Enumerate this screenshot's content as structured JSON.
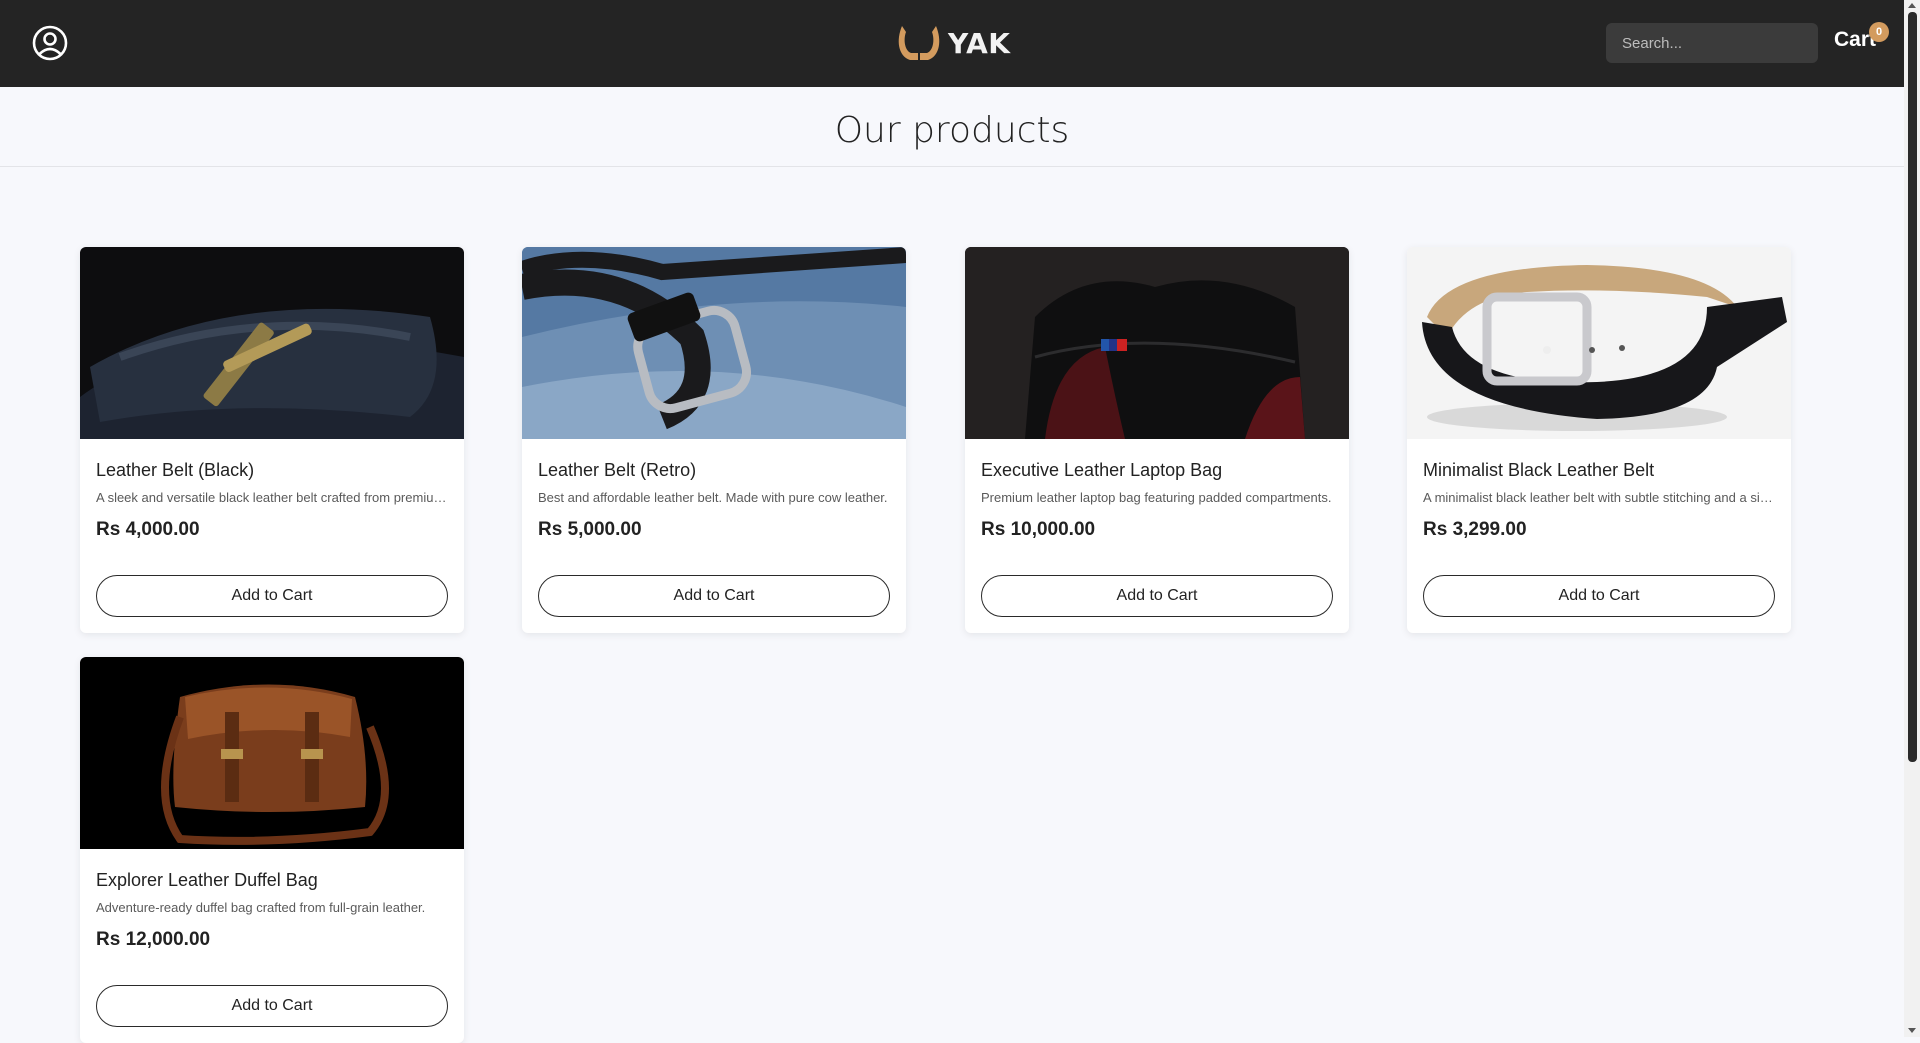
{
  "header": {
    "brand": "YAK",
    "search_placeholder": "Search...",
    "cart_label": "Cart",
    "cart_count": "0",
    "user_icon": "user-circle-icon",
    "logo_icon": "horns-icon",
    "colors": {
      "bar": "#242424",
      "accent": "#d39b5e"
    }
  },
  "main": {
    "title": "Our products",
    "products": [
      {
        "name": "Leather Belt (Black)",
        "description": "A sleek and versatile black leather belt crafted from premium full-grain leather.",
        "price": "Rs 4,000.00",
        "button": "Add to Cart"
      },
      {
        "name": "Leather Belt (Retro)",
        "description": "Best and affordable leather belt. Made with pure cow leather.",
        "price": "Rs 5,000.00",
        "button": "Add to Cart"
      },
      {
        "name": "Executive Leather Laptop Bag",
        "description": "Premium leather laptop bag featuring padded compartments.",
        "price": "Rs 10,000.00",
        "button": "Add to Cart"
      },
      {
        "name": "Minimalist Black Leather Belt",
        "description": "A minimalist black leather belt with subtle stitching and a silver buckle.",
        "price": "Rs 3,299.00",
        "button": "Add to Cart"
      },
      {
        "name": "Explorer Leather Duffel Bag",
        "description": "Adventure-ready duffel bag crafted from full-grain leather.",
        "price": "Rs 12,000.00",
        "button": "Add to Cart"
      }
    ]
  }
}
